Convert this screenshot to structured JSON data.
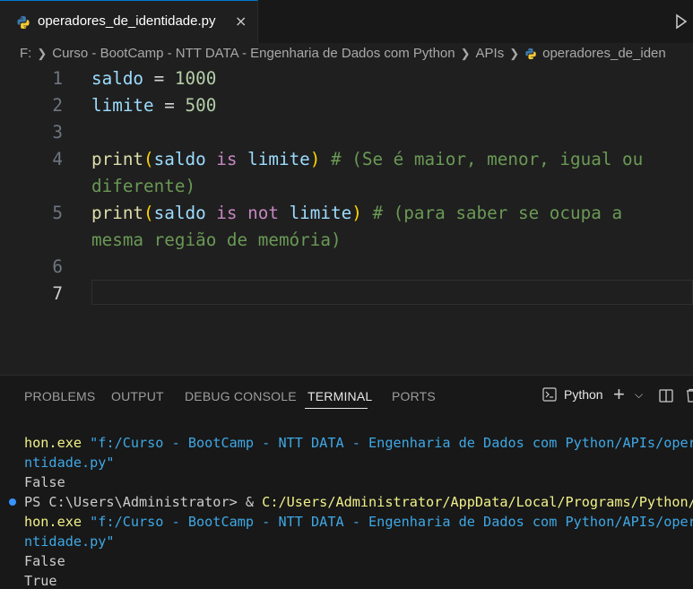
{
  "tab": {
    "filename": "operadores_de_identidade.py",
    "close": "×"
  },
  "breadcrumb": {
    "parts": [
      "F:",
      "Curso - BootCamp - NTT DATA - Engenharia de Dados com Python",
      "APIs",
      "operadores_de_iden"
    ]
  },
  "editor": {
    "line_numbers": [
      "1",
      "2",
      "3",
      "4",
      "5",
      "6",
      "7"
    ],
    "line1": {
      "var": "saldo",
      "op": " = ",
      "num": "1000"
    },
    "line2": {
      "var": "limite",
      "op": " = ",
      "num": "500"
    },
    "line4": {
      "fn": "print",
      "open": "(",
      "a": "saldo",
      "kw": " is ",
      "b": "limite",
      "close": ")",
      "comment": " # (Se é maior, menor, igual ou",
      "comment_wrap": "diferente)"
    },
    "line5": {
      "fn": "print",
      "open": "(",
      "a": "saldo",
      "kw1": " is ",
      "kw2": "not",
      "b": " limite",
      "close": ")",
      "comment": " # (para saber se ocupa a",
      "comment_wrap": "mesma região de memória)"
    }
  },
  "panel": {
    "tabs": [
      "PROBLEMS",
      "OUTPUT",
      "DEBUG CONSOLE",
      "TERMINAL",
      "PORTS"
    ],
    "active_tab": "TERMINAL",
    "terminal_profile": "Python",
    "plus": "+",
    "chevron": "⌵"
  },
  "terminal": {
    "l1_a": "hon.exe ",
    "l1_b": "\"f:/Curso - BootCamp - NTT DATA - Engenharia de Dados com Python/APIs/opera",
    "l2": "ntidade.py\"",
    "l3": "False",
    "l4_a": "PS C:\\Users\\Administrator> & ",
    "l4_b": "C:/Users/Administrator/AppData/Local/Programs/Python/P",
    "l5_a": "hon.exe ",
    "l5_b": "\"f:/Curso - BootCamp - NTT DATA - Engenharia de Dados com Python/APIs/opera",
    "l6": "ntidade.py\"",
    "l7": "False",
    "l8": "True"
  },
  "colors": {
    "accent": "#0078d4",
    "background": "#1f1f1f",
    "panel": "#181818"
  }
}
